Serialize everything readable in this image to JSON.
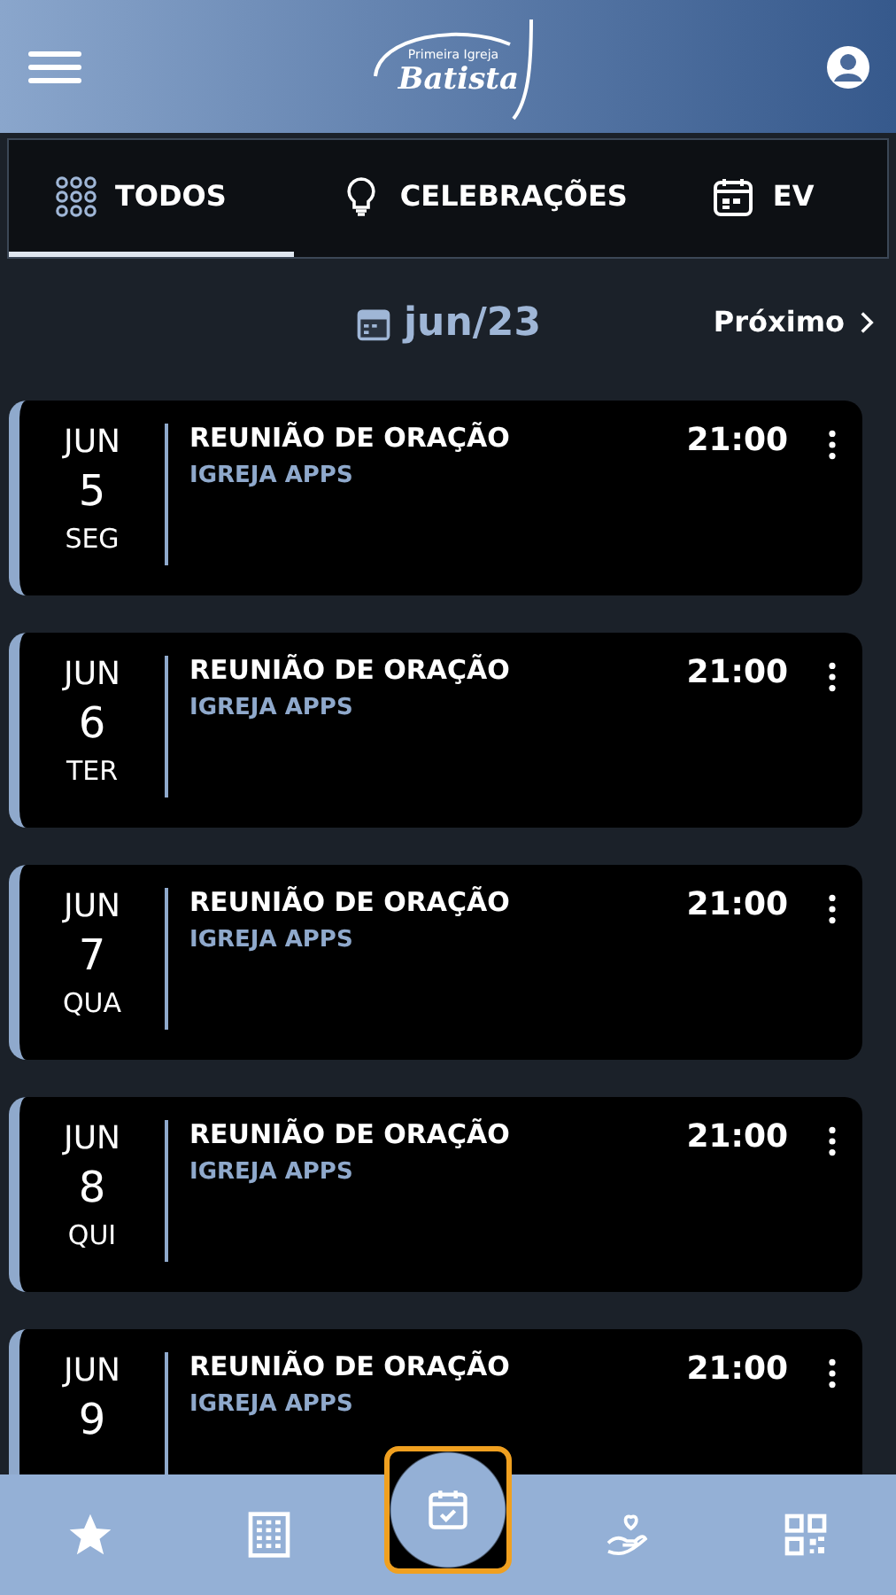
{
  "header": {
    "logo": {
      "line_1": "Primeira Igreja",
      "line_2": "Batista"
    }
  },
  "tabs": [
    {
      "label": "TODOS",
      "kind": "grid",
      "selected": true
    },
    {
      "label": "CELEBRAÇÕES",
      "kind": "bulb",
      "selected": false
    },
    {
      "label": "EV",
      "kind": "calendar",
      "selected": false
    }
  ],
  "month_nav": {
    "month": "jun/23",
    "next": "Próximo"
  },
  "events": [
    {
      "month": "JUN",
      "day": "5",
      "weekday": "SEG",
      "title": "REUNIÃO DE ORAÇÃO",
      "subtitle": "IGREJA APPS",
      "time": "21:00"
    },
    {
      "month": "JUN",
      "day": "6",
      "weekday": "TER",
      "title": "REUNIÃO DE ORAÇÃO",
      "subtitle": "IGREJA APPS",
      "time": "21:00"
    },
    {
      "month": "JUN",
      "day": "7",
      "weekday": "QUA",
      "title": "REUNIÃO DE ORAÇÃO",
      "subtitle": "IGREJA APPS",
      "time": "21:00"
    },
    {
      "month": "JUN",
      "day": "8",
      "weekday": "QUI",
      "title": "REUNIÃO DE ORAÇÃO",
      "subtitle": "IGREJA APPS",
      "time": "21:00"
    },
    {
      "month": "JUN",
      "day": "9",
      "title": "REUNIÃO DE ORAÇÃO",
      "subtitle": "IGREJA APPS",
      "time": "21:00"
    }
  ],
  "bottom_nav": [
    {
      "kind": "star",
      "selected": false
    },
    {
      "kind": "building",
      "selected": false
    },
    {
      "kind": "calendar-check",
      "selected": true
    },
    {
      "kind": "heart-hand",
      "selected": false
    },
    {
      "kind": "qr",
      "selected": false
    }
  ]
}
